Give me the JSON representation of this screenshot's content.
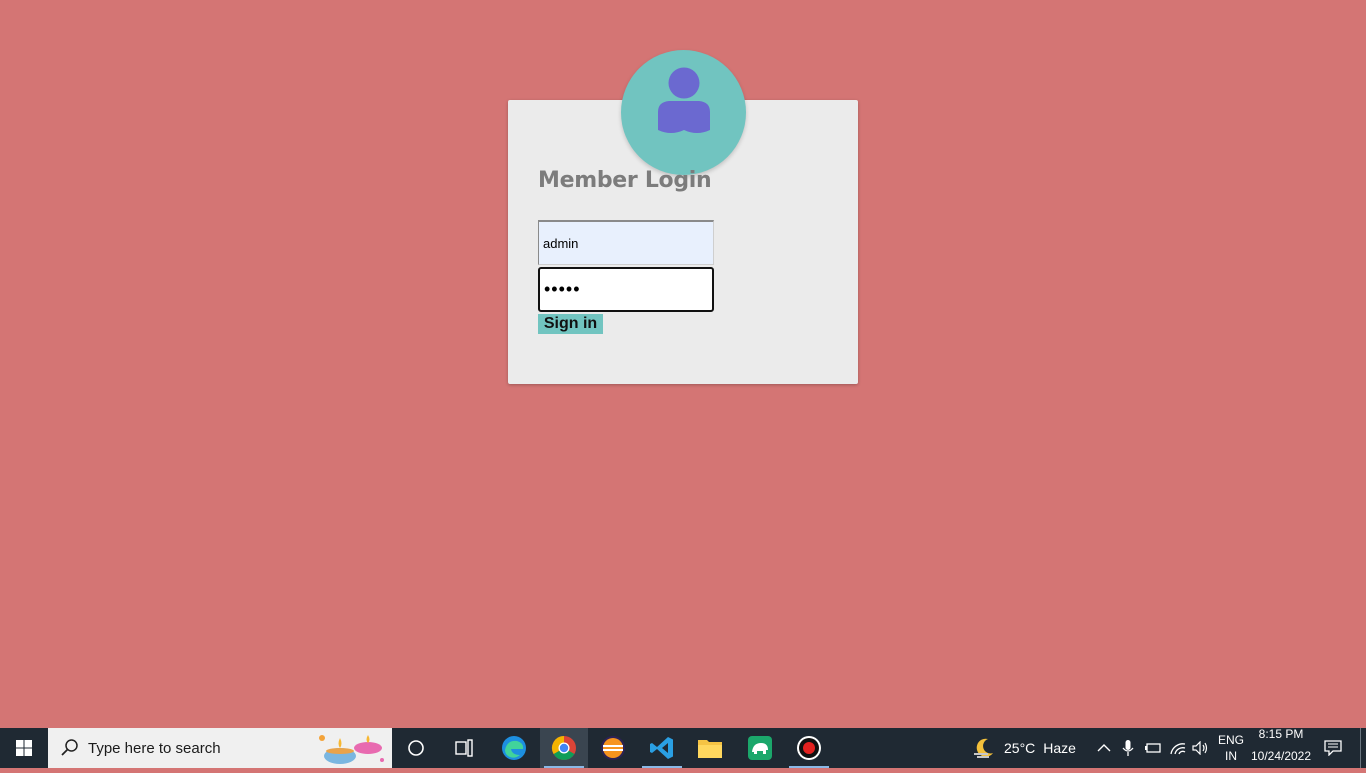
{
  "login": {
    "title": "Member Login",
    "username_value": "admin",
    "password_value": "•••••",
    "signin_label": "Sign in"
  },
  "taskbar": {
    "search_placeholder": "Type here to search",
    "weather_temp": "25°C",
    "weather_desc": "Haze",
    "lang_line1": "ENG",
    "lang_line2": "IN",
    "time": "8:15 PM",
    "date": "10/24/2022",
    "apps": [
      "cortana-icon",
      "task-view-icon",
      "edge-icon",
      "chrome-icon",
      "eclipse-icon",
      "vscode-icon",
      "file-explorer-icon",
      "green-app-icon",
      "recorder-icon"
    ]
  },
  "colors": {
    "background": "#d47574",
    "card": "#ebebeb",
    "accent": "#71c4c0",
    "avatar_figure": "#6b69d0"
  }
}
